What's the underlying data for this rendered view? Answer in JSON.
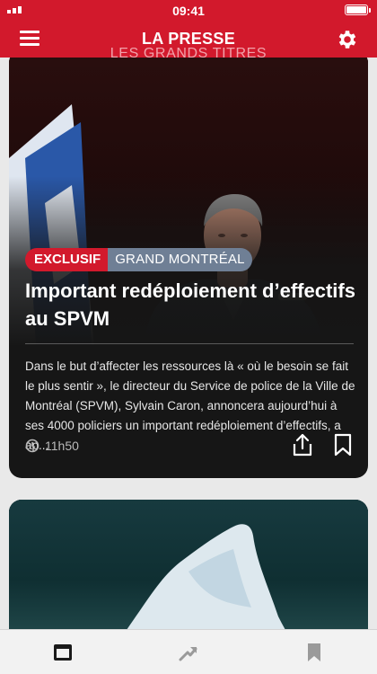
{
  "status_bar": {
    "time": "09:41"
  },
  "header": {
    "brand": "LA PRESSE",
    "section": "LES GRANDS TITRES"
  },
  "articles": [
    {
      "tags": {
        "exclusive": "EXCLUSIF",
        "region": "GRAND MONTRÉAL"
      },
      "headline": "Important redéploiement d’effectifs au SPVM",
      "summary": "Dans le but d’affecter les ressources là « où le besoin se fait le plus sentir », le directeur du Service de police de la Ville de Montréal (SPVM), Sylvain Caron, annoncera aujourd’hui à ses 4000 policiers un important redéploiement d’effectifs, a ap...",
      "time": "11h50"
    }
  ],
  "colors": {
    "brand_red": "#d2192c",
    "region_tag": "#6f7f95",
    "card_bg": "#161616"
  },
  "icons": [
    "menu-icon",
    "gear-icon",
    "clock-icon",
    "share-icon",
    "bookmark-icon",
    "news-tab-icon",
    "trending-tab-icon",
    "bookmarks-tab-icon"
  ]
}
